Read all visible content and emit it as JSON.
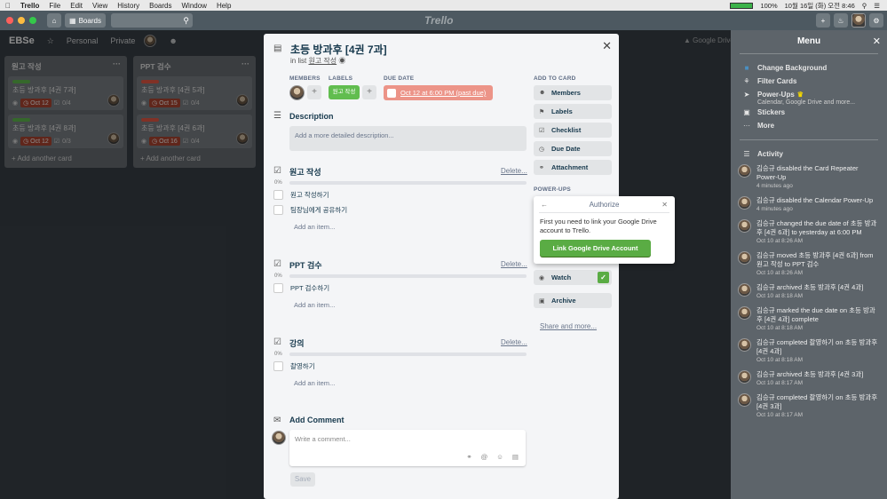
{
  "menubar": {
    "app": "Trello",
    "items": [
      "File",
      "Edit",
      "View",
      "History",
      "Boards",
      "Window",
      "Help"
    ],
    "battery": "100%",
    "datetime": "10월 16일 (화) 오전  8:46"
  },
  "header": {
    "boards_label": "Boards",
    "logo": "Trello"
  },
  "board": {
    "name": "EBSe",
    "team": "Personal",
    "visibility": "Private",
    "google_drive": "Google Drive",
    "lists": [
      {
        "title": "원고 작성",
        "cards": [
          {
            "title": "초등 방과후 [4권 7과]",
            "due": "Oct 12",
            "checklist": "0/4",
            "label_color": "#61bd4f"
          },
          {
            "title": "초등 방과후 [4권 8과]",
            "due": "Oct 12",
            "checklist": "0/3",
            "label_color": "#61bd4f"
          }
        ],
        "add_label": "Add another card"
      },
      {
        "title": "PPT 검수",
        "cards": [
          {
            "title": "초등 방과후 [4권 5과]",
            "due": "Oct 15",
            "checklist": "0/4",
            "label_color": "#eb5a46"
          },
          {
            "title": "초등 방과후 [4권 6과]",
            "due": "Oct 16",
            "checklist": "0/4",
            "label_color": "#eb5a46"
          }
        ],
        "add_label": "Add another card"
      }
    ]
  },
  "menu": {
    "title": "Menu",
    "items": [
      {
        "label": "Change Background"
      },
      {
        "label": "Filter Cards"
      },
      {
        "label": "Power-Ups",
        "sub": "Calendar, Google Drive and more..."
      },
      {
        "label": "Stickers"
      },
      {
        "label": "More"
      }
    ],
    "activity_title": "Activity",
    "activity": [
      {
        "text": "김승규 disabled the Card Repeater Power-Up",
        "time": "4 minutes ago"
      },
      {
        "text": "김승규 disabled the Calendar Power-Up",
        "time": "4 minutes ago"
      },
      {
        "text": "김승규 changed the due date of 초등 방과후 [4권 6과] to yesterday at 6:00 PM",
        "time": "Oct 10 at 8:26 AM"
      },
      {
        "text": "김승규 moved 초등 방과후 [4권 6과] from 원고 작성 to PPT 검수",
        "time": "Oct 10 at 8:26 AM"
      },
      {
        "text": "김승규 archived 초등 방과후 [4권 4과]",
        "time": "Oct 10 at 8:18 AM"
      },
      {
        "text": "김승규 marked the due date on 초등 방과후 [4권 4과] complete",
        "time": "Oct 10 at 8:18 AM"
      },
      {
        "text": "김승규 completed 촬영하기 on 초등 방과후 [4권 4과]",
        "time": "Oct 10 at 8:18 AM"
      },
      {
        "text": "김승규 archived 초등 방과후 [4권 3과]",
        "time": "Oct 10 at 8:17 AM"
      },
      {
        "text": "김승규 completed 촬영하기 on 초등 방과후 [4권 3과]",
        "time": "Oct 10 at 8:17 AM"
      }
    ]
  },
  "modal": {
    "title": "초등 방과후 [4권 7과]",
    "in_list_prefix": "in list",
    "in_list": "원고 작성",
    "members_hd": "MEMBERS",
    "labels_hd": "LABELS",
    "label_text": "원고 작성",
    "due_hd": "DUE DATE",
    "due_text": "Oct 12 at 6:00 PM (past due)",
    "description_title": "Description",
    "description_placeholder": "Add a more detailed description...",
    "checklists": [
      {
        "title": "원고 작성",
        "percent": "0%",
        "items": [
          "원고 작성하기",
          "팀장님에게 공유하기"
        ],
        "delete": "Delete...",
        "add": "Add an item..."
      },
      {
        "title": "PPT 검수",
        "percent": "0%",
        "items": [
          "PPT 검수하기"
        ],
        "delete": "Delete...",
        "add": "Add an item..."
      },
      {
        "title": "강의",
        "percent": "0%",
        "items": [
          "촬영하기"
        ],
        "delete": "Delete...",
        "add": "Add an item..."
      }
    ],
    "add_comment_title": "Add Comment",
    "comment_placeholder": "Write a comment...",
    "save": "Save",
    "add_to_card_hd": "ADD TO CARD",
    "add_buttons": [
      "Members",
      "Labels",
      "Checklist",
      "Due Date",
      "Attachment"
    ],
    "powerups_hd": "POWER-UPS",
    "watch": "Watch",
    "archive": "Archive",
    "share": "Share and more..."
  },
  "authorize": {
    "title": "Authorize",
    "message": "First you need to link your Google Drive account to Trello.",
    "button": "Link Google Drive Account"
  }
}
